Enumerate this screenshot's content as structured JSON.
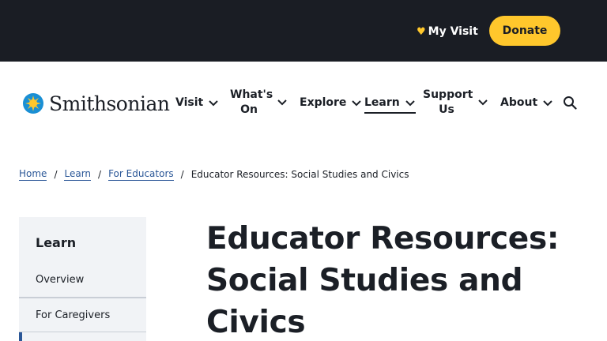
{
  "topbar": {
    "my_visit_label": "My Visit",
    "donate_label": "Donate",
    "accent_color": "#ffc72c",
    "background_color": "#1a1d24"
  },
  "logo": {
    "wordmark": "Smithsonian",
    "icon": "sun-icon"
  },
  "nav": {
    "items": [
      {
        "label": "Visit",
        "has_dropdown": true
      },
      {
        "label": "What's On",
        "has_dropdown": true
      },
      {
        "label": "Explore",
        "has_dropdown": true
      },
      {
        "label": "Learn",
        "has_dropdown": true,
        "active": true
      },
      {
        "label": "Support Us",
        "has_dropdown": true
      },
      {
        "label": "About",
        "has_dropdown": true
      }
    ],
    "search_icon": "search-icon"
  },
  "breadcrumb": {
    "items": [
      {
        "label": "Home",
        "link": true
      },
      {
        "label": "Learn",
        "link": true
      },
      {
        "label": "For Educators",
        "link": true
      },
      {
        "label": "Educator Resources: Social Studies and Civics",
        "link": false
      }
    ],
    "separator": "/"
  },
  "sidebar": {
    "title": "Learn",
    "items": [
      {
        "label": "Overview"
      },
      {
        "label": "For Caregivers"
      },
      {
        "label": ""
      }
    ]
  },
  "main": {
    "title": "Educator Resources: Social Studies and Civics"
  }
}
